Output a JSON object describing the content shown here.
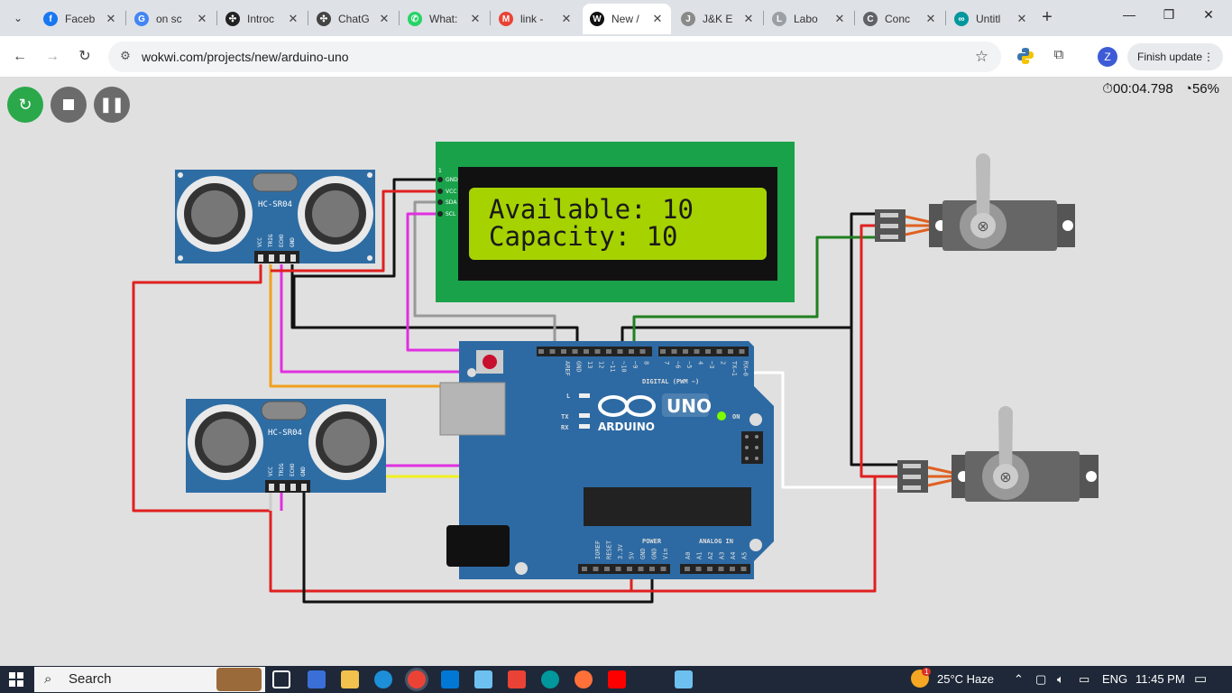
{
  "browser": {
    "tabs": [
      {
        "title": "Faceb",
        "icon": "facebook-icon",
        "color": "#1877f2",
        "glyph": "f"
      },
      {
        "title": "on sc",
        "icon": "google-icon",
        "color": "#4285f4",
        "glyph": "G"
      },
      {
        "title": "Introc",
        "icon": "openai-icon",
        "color": "#222222",
        "glyph": "✣"
      },
      {
        "title": "ChatG",
        "icon": "openai-icon",
        "color": "#444444",
        "glyph": "✣"
      },
      {
        "title": "What:",
        "icon": "whatsapp-icon",
        "color": "#25d366",
        "glyph": "✆"
      },
      {
        "title": "link -",
        "icon": "gmail-icon",
        "color": "#ea4335",
        "glyph": "M"
      },
      {
        "title": "New /",
        "icon": "wokwi-icon",
        "color": "#111111",
        "glyph": "W"
      },
      {
        "title": "J&K E",
        "icon": "site-icon",
        "color": "#8a8a8a",
        "glyph": "J"
      },
      {
        "title": "Labo",
        "icon": "site-icon",
        "color": "#9aa0a6",
        "glyph": "L"
      },
      {
        "title": "Conc",
        "icon": "site-icon",
        "color": "#5f6368",
        "glyph": "C"
      },
      {
        "title": "Untitl",
        "icon": "arduino-icon",
        "color": "#00979d",
        "glyph": "∞"
      }
    ],
    "active_tab": 6,
    "url": "wokwi.com/projects/new/arduino-uno",
    "profile_initial": "Z",
    "finish_update": "Finish update"
  },
  "simulator": {
    "timer": "00:04.798",
    "speed": "56%",
    "lcd": {
      "line1": "Available: 10",
      "line2": "Capacity: 10",
      "pins": [
        "1",
        "GND",
        "VCC",
        "SDA",
        "SCL"
      ]
    },
    "sensor_label": "HC-SR04",
    "sensor_pins": [
      "VCC",
      "TRIG",
      "ECHO",
      "GND"
    ],
    "arduino": {
      "brand": "ARDUINO",
      "model": "UNO",
      "on_label": "ON",
      "digital_label": "DIGITAL (PWM ~)",
      "power_label": "POWER",
      "analog_label": "ANALOG IN",
      "l_label": "L",
      "tx_label": "TX",
      "rx_label": "RX",
      "top_pins": [
        "AREF",
        "GND",
        "13",
        "12",
        "~11",
        "~10",
        "~9",
        "8",
        "7",
        "~6",
        "~5",
        "4",
        "~3",
        "2",
        "TX→1",
        "RX←0"
      ],
      "power_pins": [
        "IOREF",
        "RESET",
        "3.3V",
        "5V",
        "GND",
        "GND",
        "Vin"
      ],
      "analog_pins": [
        "A0",
        "A1",
        "A2",
        "A3",
        "A4",
        "A5"
      ]
    }
  },
  "taskbar": {
    "search": "Search",
    "weather": "25°C Haze",
    "weather_badge": "1",
    "language": "ENG",
    "time": "11:45 PM"
  },
  "colors": {
    "wire_red": "#e02020",
    "wire_black": "#111111",
    "wire_orange": "#f0a020",
    "wire_magenta": "#e030e0",
    "wire_yellow": "#f0f020",
    "wire_green": "#208020",
    "wire_gray": "#999999",
    "lcd_green": "#1aa24a",
    "lcd_screen": "#a6d200",
    "arduino_blue": "#2d6aa3",
    "sensor_blue": "#2e6da4"
  }
}
